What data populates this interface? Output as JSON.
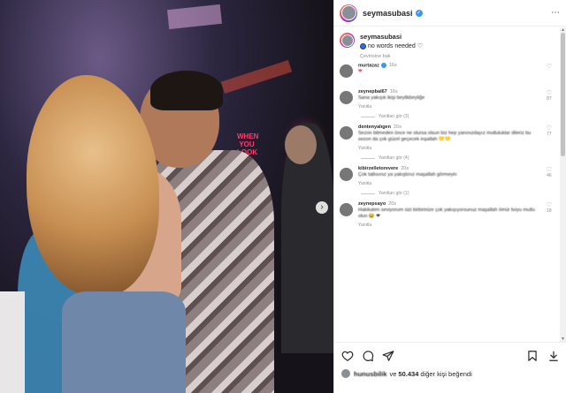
{
  "photo": {
    "neon_sign": "WHEN YOU LOOK"
  },
  "post": {
    "username": "seymasubasi",
    "caption_user": "seymasubasi",
    "caption_text": "no words needed",
    "see_translation": "Çevirisine bak"
  },
  "comments": [
    {
      "user": "murtazaz",
      "verified": true,
      "time": "16s",
      "text": "❤",
      "likes": "",
      "reply": "",
      "replies_label": ""
    },
    {
      "user": "zeynepbal67",
      "verified": false,
      "time": "16s",
      "text": "Sana yakışık ikişi beylikbeyliğe",
      "likes": "87",
      "reply": "Yanıtla",
      "replies_label": "Yanıtları gör (3)"
    },
    {
      "user": "dentenyalıgen",
      "verified": false,
      "time": "20s",
      "text": "Sezon bitmeden önce ne olursa olsun biz hep yanınızdayız mutluluklar dileriz bu sezon da çok güzel geçecek inşallah 💛💛",
      "likes": "77",
      "reply": "Yanıtla",
      "replies_label": "Yanıtları gör (4)"
    },
    {
      "user": "kibirzelletorevere",
      "verified": false,
      "time": "20s",
      "text": "Çok tatlısınız ya yakıştınız maşallah görmeyin",
      "likes": "46",
      "reply": "Yanıtla",
      "replies_label": "Yanıtları gör (1)"
    },
    {
      "user": "zeynepsayo",
      "verified": false,
      "time": "20s",
      "text": "Hakikaten seviyorum sizi birbirinize çok yakışıyorsunuz maşallah ömür boyu mutlu olun 😂 ❤",
      "likes": "18",
      "reply": "Yanıtla",
      "replies_label": ""
    }
  ],
  "footer": {
    "liker": "hunusbilik",
    "likes_prefix": "ve",
    "likes_count": "50.434",
    "likes_suffix": "diğer kişi beğendi"
  }
}
